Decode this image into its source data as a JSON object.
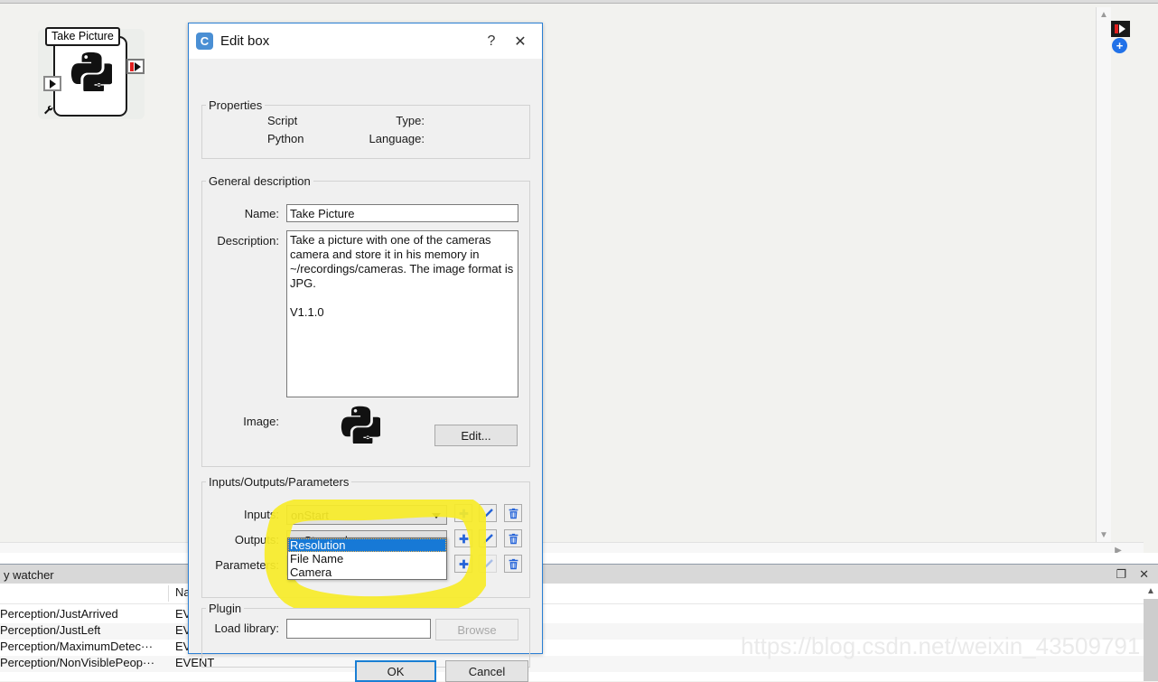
{
  "canvas": {
    "node": {
      "title": "Take Picture",
      "input_port": "input-port",
      "output_port": "output-port",
      "image_icon": "python-logo-icon",
      "settings_icon": "wrench-icon"
    },
    "right_tools": {
      "output_port_icon": "output-port-icon",
      "add_icon": "plus-circle-icon"
    }
  },
  "dialog": {
    "title": "Edit box",
    "icon": "choregraphe-c-icon",
    "help_label": "?",
    "close_label": "✕",
    "properties": {
      "legend": "Properties",
      "type_label": "Type:",
      "type_value": "Script",
      "language_label": "Language:",
      "language_value": "Python"
    },
    "general": {
      "legend": "General description",
      "name_label": "Name:",
      "name_value": "Take Picture",
      "description_label": "Description:",
      "description_value": "Take a picture with one of the cameras camera and store it in his memory in ~/recordings/cameras. The image format is JPG.\n\nV1.1.0",
      "image_label": "Image:",
      "image_icon": "python-logo-icon",
      "edit_button": "Edit..."
    },
    "iop": {
      "legend": "Inputs/Outputs/Parameters",
      "inputs_label": "Inputs:",
      "inputs_value": "onStart",
      "outputs_label": "Outputs:",
      "outputs_value": "onStopped",
      "parameters_label": "Parameters:",
      "parameters_value": "Resolution",
      "add_icon": "plus-icon",
      "edit_icon": "pencil-icon",
      "delete_icon": "trash-icon",
      "dropdown_options": [
        "Resolution",
        "File Name",
        "Camera"
      ],
      "dropdown_selected_index": 0
    },
    "plugin": {
      "legend": "Plugin",
      "load_library_label": "Load library:",
      "load_library_value": "",
      "browse_button": "Browse"
    },
    "footer": {
      "ok_button": "OK",
      "cancel_button": "Cancel"
    }
  },
  "bottom_panel": {
    "title": "y watcher",
    "float_icon": "float-window-icon",
    "close_icon": "close-icon",
    "columns": [
      "",
      "Na"
    ],
    "rows": [
      {
        "name": "Perception/JustArrived",
        "type": "EVENT"
      },
      {
        "name": "Perception/JustLeft",
        "type": "EVENT"
      },
      {
        "name": "Perception/MaximumDetec···",
        "type": "EVENT"
      },
      {
        "name": "Perception/NonVisiblePeop···",
        "type": "EVENT"
      }
    ]
  },
  "watermark": "https://blog.csdn.net/weixin_43509791",
  "colors": {
    "accent": "#1a7fd4",
    "icon_blue": "#2463d8",
    "highlight_yellow": "#f7ec28",
    "selection_blue": "#1779d6"
  }
}
